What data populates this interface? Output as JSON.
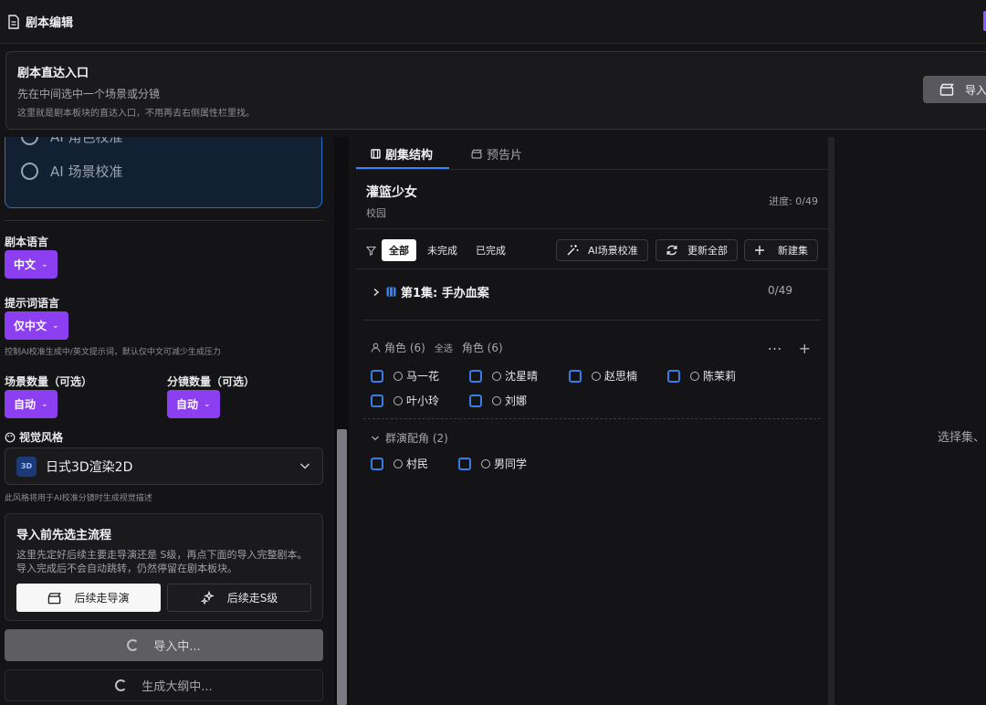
{
  "window": {
    "title": "剧本编辑"
  },
  "banner": {
    "title": "剧本直达入口",
    "subtitle": "先在中间选中一个场景或分镜",
    "note": "这里就是剧本板块的直达入口，不用再去右侧属性栏里找。",
    "import_button": "导入"
  },
  "left": {
    "calibration_options": [
      "AI 角色校准",
      "AI 场景校准"
    ],
    "script_language": {
      "label": "剧本语言",
      "value": "中文"
    },
    "prompt_language": {
      "label": "提示词语言",
      "value": "仅中文",
      "hint": "控制AI校准生成中/英文提示词，默认仅中文可减少生成压力"
    },
    "scene_count": {
      "label": "场景数量（可选）",
      "value": "自动"
    },
    "shot_count": {
      "label": "分镜数量（可选）",
      "value": "自动"
    },
    "visual_style": {
      "label": "视觉风格",
      "badge": "3D",
      "value": "日式3D渲染2D",
      "hint": "此风格将用于AI校准分镜时生成视觉描述"
    },
    "flow": {
      "title": "导入前先选主流程",
      "desc": "这里先定好后续主要走导演还是 S级，再点下面的导入完整剧本。 导入完成后不会自动跳转，仍然停留在剧本板块。",
      "option_director": "后续走导演",
      "option_s": "后续走S级"
    },
    "importing_button": "导入中...",
    "outline_button": "生成大纲中..."
  },
  "middle": {
    "tabs": [
      "剧集结构",
      "预告片"
    ],
    "project": {
      "title": "灌篮少女",
      "genre": "校园",
      "progress": "进度: 0/49"
    },
    "filters": [
      "全部",
      "未完成",
      "已完成"
    ],
    "actions": {
      "scene_calibrate": "AI场景校准",
      "refresh_all": "更新全部",
      "new_episode": "新建集"
    },
    "episode": {
      "title": "第1集: 手办血案",
      "progress": "0/49"
    },
    "characters": {
      "label": "角色 (6)",
      "select_all": "全选",
      "label2": "角色 (6)",
      "names": [
        "马一花",
        "沈星晴",
        "赵思楠",
        "陈茉莉",
        "叶小玲",
        "刘娜"
      ]
    },
    "extras": {
      "label": "群演配角 (2)",
      "names": [
        "村民",
        "男同学"
      ]
    }
  },
  "right": {
    "empty_text": "选择集、"
  },
  "colors": {
    "accent": "#8b3ff0",
    "tab_blue": "#3b82f6",
    "checkbox_blue": "#3b7be8"
  }
}
